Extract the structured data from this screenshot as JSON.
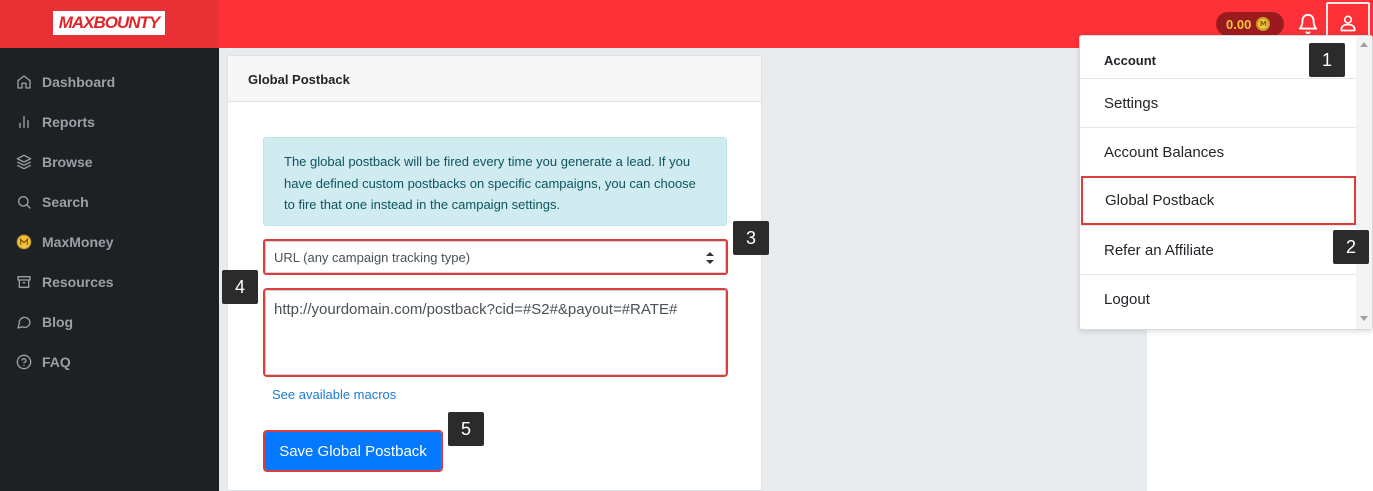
{
  "brand": {
    "logo_text": "MAXBOUNTY"
  },
  "header": {
    "balance": "0.00",
    "coin_symbol": "M"
  },
  "sidebar": {
    "items": [
      {
        "label": "Dashboard",
        "icon": "home-icon"
      },
      {
        "label": "Reports",
        "icon": "bar-chart-icon"
      },
      {
        "label": "Browse",
        "icon": "layers-icon"
      },
      {
        "label": "Search",
        "icon": "search-icon"
      },
      {
        "label": "MaxMoney",
        "icon": "maxmoney-coin-icon"
      },
      {
        "label": "Resources",
        "icon": "archive-box-icon"
      },
      {
        "label": "Blog",
        "icon": "chat-bubble-icon"
      },
      {
        "label": "FAQ",
        "icon": "question-circle-icon"
      }
    ]
  },
  "card": {
    "title": "Global Postback",
    "alert_text": "The global postback will be fired every time you generate a lead. If you have defined custom postbacks on specific campaigns, you can choose to fire that one instead in the campaign settings.",
    "select_value": "URL (any campaign tracking type)",
    "postback_url": "http://yourdomain.com/postback?cid=#S2#&payout=#RATE#",
    "macros_link": "See available macros",
    "save_label": "Save Global Postback"
  },
  "dropdown": {
    "header": "Account",
    "items": [
      "Settings",
      "Account Balances",
      "Global Postback",
      "Refer an Affiliate",
      "Logout"
    ]
  },
  "steps": [
    "1",
    "2",
    "3",
    "4",
    "5"
  ],
  "colors": {
    "topbar": "#fd3137",
    "sidebar": "#1e2124",
    "primary_button": "#0479ff",
    "highlight_border": "#dc3c3c",
    "alert_bg": "#d1ecf1"
  }
}
